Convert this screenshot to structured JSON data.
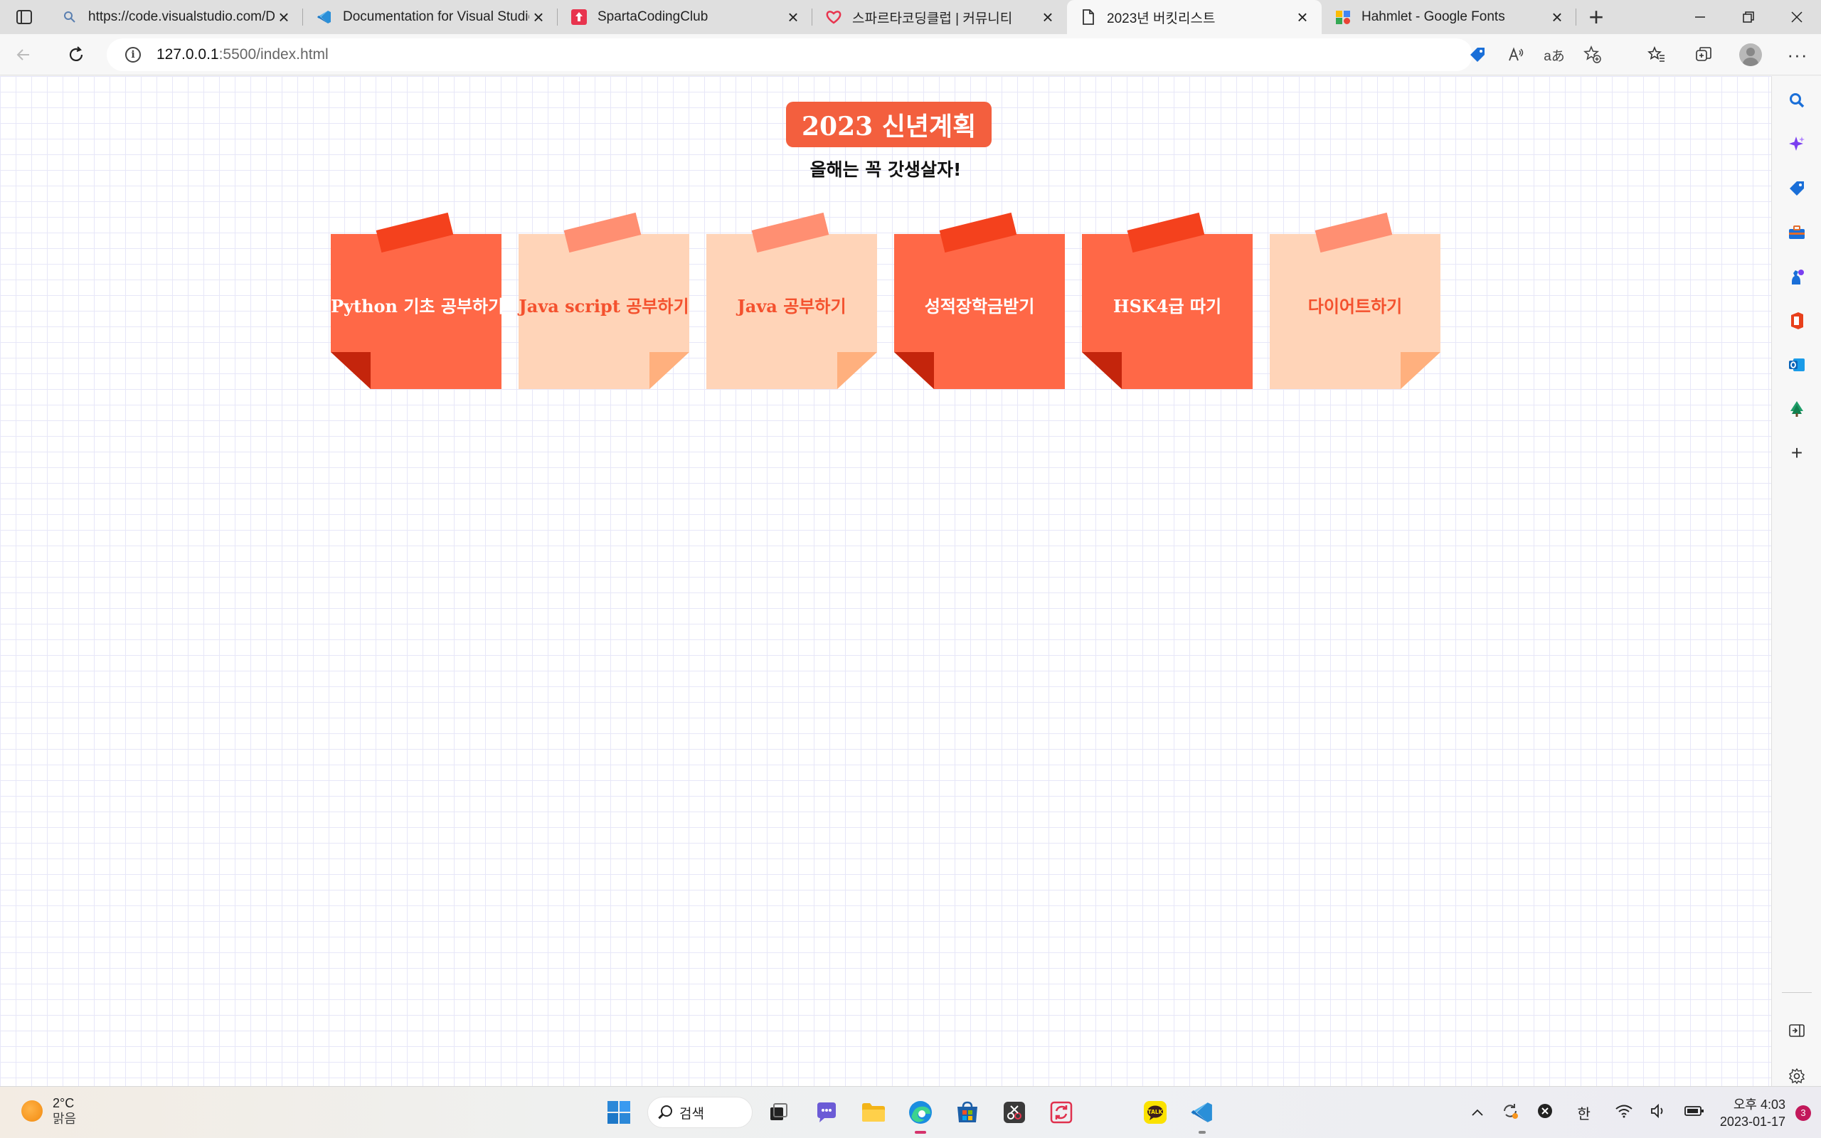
{
  "browser": {
    "tabs": [
      {
        "title": "https://code.visualstudio.com/Do",
        "favicon": "search-favicon"
      },
      {
        "title": "Documentation for Visual Studio",
        "favicon": "vscode-favicon"
      },
      {
        "title": "SpartaCodingClub",
        "favicon": "sparta-favicon"
      },
      {
        "title": "스파르타코딩클럽 | 커뮤니티",
        "favicon": "heart-favicon"
      },
      {
        "title": "2023년 버킷리스트",
        "favicon": "page-favicon"
      },
      {
        "title": "Hahmlet - Google Fonts",
        "favicon": "google-fonts-favicon"
      }
    ],
    "active_tab": 4,
    "new_tab_label": "+",
    "address": {
      "host": "127.0.0.1",
      "path": ":5500/index.html"
    }
  },
  "page": {
    "title": "2023 신년계획",
    "subtitle": "올해는 꼭 갓생살자!",
    "notes": [
      {
        "label": "Python 기초 공부하기",
        "style": "dark"
      },
      {
        "label": "Java script 공부하기",
        "style": "light"
      },
      {
        "label": "Java 공부하기",
        "style": "light"
      },
      {
        "label": "성적장학금받기",
        "style": "dark"
      },
      {
        "label": "HSK4급 따기",
        "style": "dark"
      },
      {
        "label": "다이어트하기",
        "style": "light"
      }
    ],
    "colors": {
      "heading": "#f35f3e",
      "dark_note": "#ff6847",
      "light_note": "#ffd4b8",
      "grid": "#e7e7f8"
    }
  },
  "taskbar": {
    "weather": {
      "temp": "2°C",
      "condition": "맑음"
    },
    "search_label": "검색",
    "ime": "한",
    "clock": {
      "time": "오후 4:03",
      "date": "2023-01-17"
    },
    "notification_count": "3"
  }
}
